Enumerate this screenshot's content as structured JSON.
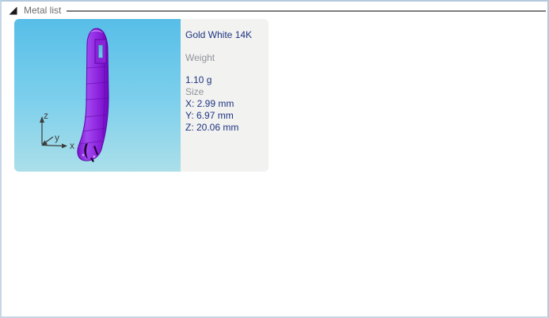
{
  "header": {
    "title": "Metal list"
  },
  "card": {
    "name": "Gold White 14K",
    "weight_label": "Weight",
    "weight_value": "1.10 g",
    "size_label": "Size",
    "size": {
      "x": "X: 2.99 mm",
      "y": "Y: 6.97 mm",
      "z": "Z: 20.06 mm"
    }
  },
  "preview": {
    "axis_labels": {
      "x": "x",
      "y": "y",
      "z": "z"
    }
  },
  "colors": {
    "window_border": "#b3c9de",
    "header_text": "#6e6e6e",
    "separator_line": "#7c7c7c",
    "name_text": "#1e3480",
    "muted_label_text": "#8e9399",
    "info_panel_bg": "#f2f2f1",
    "preview_gradient_top": "#57bee8",
    "preview_gradient_bottom": "#abdfe9",
    "model_purple": "#9430e4"
  }
}
